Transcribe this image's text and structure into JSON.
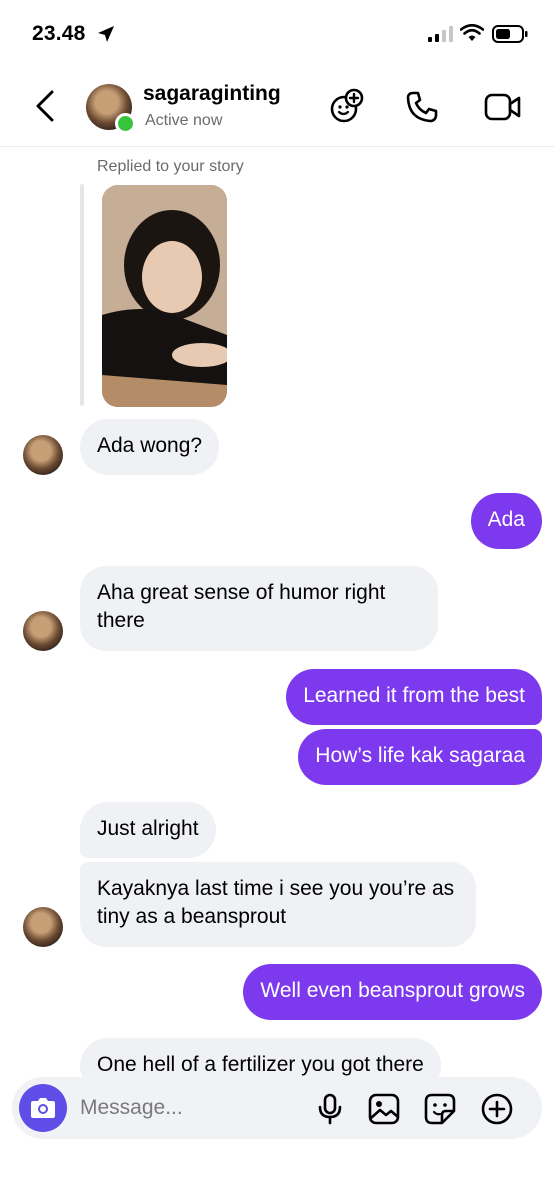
{
  "status_bar": {
    "time": "23.48"
  },
  "header": {
    "username": "sagaraginting",
    "status": "Active now"
  },
  "story_reply": {
    "label": "Replied to your story"
  },
  "messages": [
    {
      "side": "in",
      "text": "Ada wong?"
    },
    {
      "side": "out",
      "text": "Ada"
    },
    {
      "side": "in",
      "text": "Aha great sense of humor right there"
    },
    {
      "side": "out",
      "text": "Learned it from the best"
    },
    {
      "side": "out",
      "text": "How’s life kak sagaraa"
    },
    {
      "side": "in",
      "text": "Just alright"
    },
    {
      "side": "in",
      "text": "Kayaknya last time i see you you’re as tiny as a beansprout"
    },
    {
      "side": "out",
      "text": "Well even beansprout grows"
    },
    {
      "side": "in",
      "text": "One hell of a fertilizer you got there"
    }
  ],
  "composer": {
    "placeholder": "Message..."
  },
  "colors": {
    "outgoing_bubble": "#7c39ee",
    "incoming_bubble": "#eff1f5",
    "camera_button": "#5f4de8",
    "online_dot": "#37c43c"
  },
  "icons": [
    "location-arrow-icon",
    "signal-icon",
    "wifi-icon",
    "battery-icon",
    "back-chevron-icon",
    "effects-icon",
    "phone-icon",
    "video-camera-icon",
    "camera-icon",
    "microphone-icon",
    "gallery-icon",
    "sticker-icon",
    "plus-circle-icon"
  ]
}
